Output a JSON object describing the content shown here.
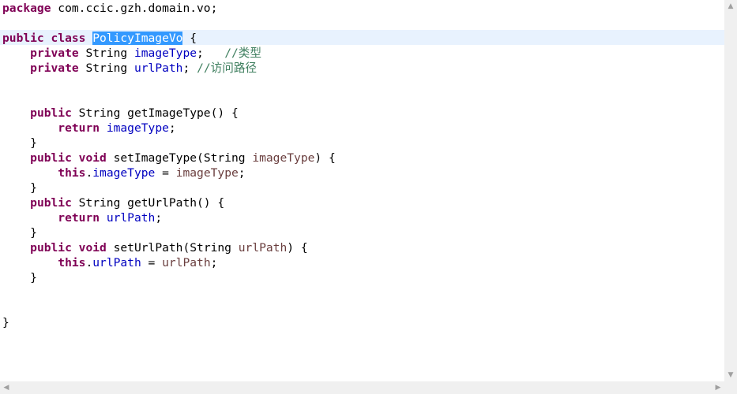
{
  "editor": {
    "code": {
      "l1_kw": "package",
      "l1_rest": " com.ccic.gzh.domain.vo;",
      "l3_kw": "public class",
      "l3_sp": " ",
      "l3_class": "PolicyImageVo",
      "l3_rest": " {",
      "l4_indent": "    ",
      "l4_kw": "private",
      "l4_type": " String ",
      "l4_field": "imageType",
      "l4_semi": ";   ",
      "l4_comment": "//类型",
      "l5_indent": "    ",
      "l5_kw": "private",
      "l5_type": " String ",
      "l5_field": "urlPath",
      "l5_semi": "; ",
      "l5_comment": "//访问路径",
      "l8_indent": "    ",
      "l8_kw": "public",
      "l8_rest": " String getImageType() {",
      "l9_indent": "        ",
      "l9_kw": "return",
      "l9_sp": " ",
      "l9_field": "imageType",
      "l9_semi": ";",
      "l10": "    }",
      "l11_indent": "    ",
      "l11_kw": "public void",
      "l11_mid": " setImageType(String ",
      "l11_param": "imageType",
      "l11_end": ") {",
      "l12_indent": "        ",
      "l12_kw": "this",
      "l12_dot": ".",
      "l12_field": "imageType",
      "l12_eq": " = ",
      "l12_param": "imageType",
      "l12_semi": ";",
      "l13": "    }",
      "l14_indent": "    ",
      "l14_kw": "public",
      "l14_rest": " String getUrlPath() {",
      "l15_indent": "        ",
      "l15_kw": "return",
      "l15_sp": " ",
      "l15_field": "urlPath",
      "l15_semi": ";",
      "l16": "    }",
      "l17_indent": "    ",
      "l17_kw": "public void",
      "l17_mid": " setUrlPath(String ",
      "l17_param": "urlPath",
      "l17_end": ") {",
      "l18_indent": "        ",
      "l18_kw": "this",
      "l18_dot": ".",
      "l18_field": "urlPath",
      "l18_eq": " = ",
      "l18_param": "urlPath",
      "l18_semi": ";",
      "l19": "    }",
      "l22": "}"
    }
  },
  "scrollbars": {
    "up_arrow": "▲",
    "down_arrow": "▼",
    "left_arrow": "◀",
    "right_arrow": "▶"
  },
  "colors": {
    "keyword": "#7f0055",
    "field": "#0000c0",
    "parameter": "#6a3e3e",
    "comment": "#3f7f5f",
    "current_line": "#e8f2fe",
    "selection": "#3399ff"
  }
}
